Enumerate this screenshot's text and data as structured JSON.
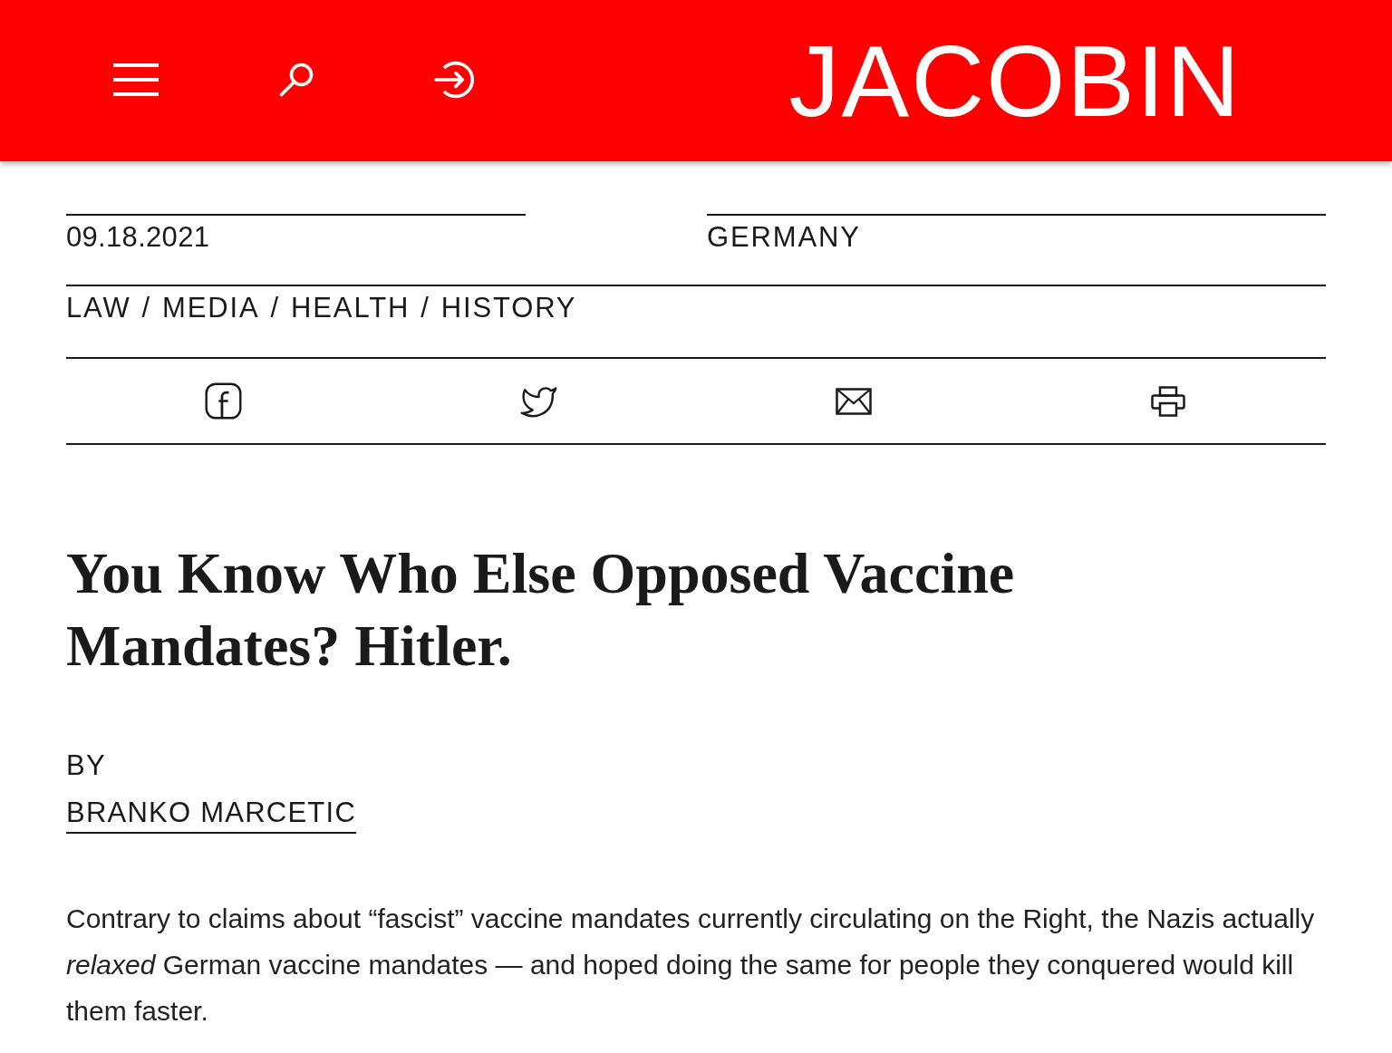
{
  "header": {
    "brand": "JACOBIN"
  },
  "meta": {
    "date": "09.18.2021",
    "region": "GERMANY",
    "tags": [
      {
        "label": "LAW"
      },
      {
        "label": "MEDIA"
      },
      {
        "label": "HEALTH"
      },
      {
        "label": "HISTORY"
      }
    ],
    "separators": [
      "/",
      "/",
      "/"
    ]
  },
  "article": {
    "title": "You Know Who Else Opposed Vaccine Mandates? Hitler.",
    "byline_label": "BY",
    "author": "BRANKO MARCETIC",
    "summary": "Contrary to claims about “fascist” vaccine mandates currently circulating on the Right, the Nazis actually *relaxed* German vaccine mandates — and hoped doing the same for people they conquered would kill them faster."
  }
}
